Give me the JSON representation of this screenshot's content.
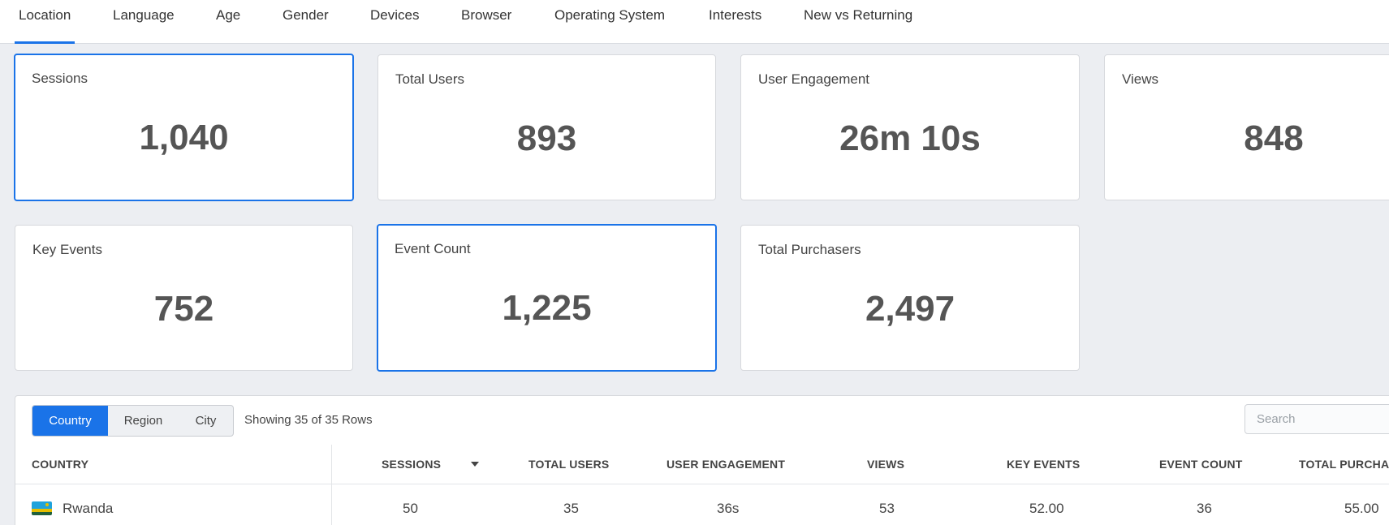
{
  "tabs": [
    {
      "label": "Location",
      "active": true
    },
    {
      "label": "Language"
    },
    {
      "label": "Age"
    },
    {
      "label": "Gender"
    },
    {
      "label": "Devices"
    },
    {
      "label": "Browser"
    },
    {
      "label": "Operating System"
    },
    {
      "label": "Interests"
    },
    {
      "label": "New vs Returning"
    }
  ],
  "metrics": [
    {
      "label": "Sessions",
      "value": "1,040",
      "selected": true
    },
    {
      "label": "Total Users",
      "value": "893"
    },
    {
      "label": "User Engagement",
      "value": "26m 10s"
    },
    {
      "label": "Views",
      "value": "848"
    },
    {
      "label": "Key Events",
      "value": "752"
    },
    {
      "label": "Event Count",
      "value": "1,225",
      "selected": true
    },
    {
      "label": "Total Purchasers",
      "value": "2,497"
    }
  ],
  "table": {
    "segments": [
      {
        "label": "Country",
        "active": true
      },
      {
        "label": "Region"
      },
      {
        "label": "City"
      }
    ],
    "row_count_text": "Showing 35 of 35 Rows",
    "search_placeholder": "Search",
    "columns": [
      "COUNTRY",
      "SESSIONS",
      "TOTAL USERS",
      "USER ENGAGEMENT",
      "VIEWS",
      "KEY EVENTS",
      "EVENT COUNT",
      "TOTAL PURCHA"
    ],
    "sorted_column": "SESSIONS",
    "sort_direction": "descending",
    "rows": [
      {
        "flag": "rwanda-flag-icon",
        "cells": [
          "Rwanda",
          "50",
          "35",
          "36s",
          "53",
          "52.00",
          "36",
          "55.00"
        ]
      }
    ]
  },
  "colors": {
    "accent": "#1a73e8",
    "background": "#eceef2"
  }
}
